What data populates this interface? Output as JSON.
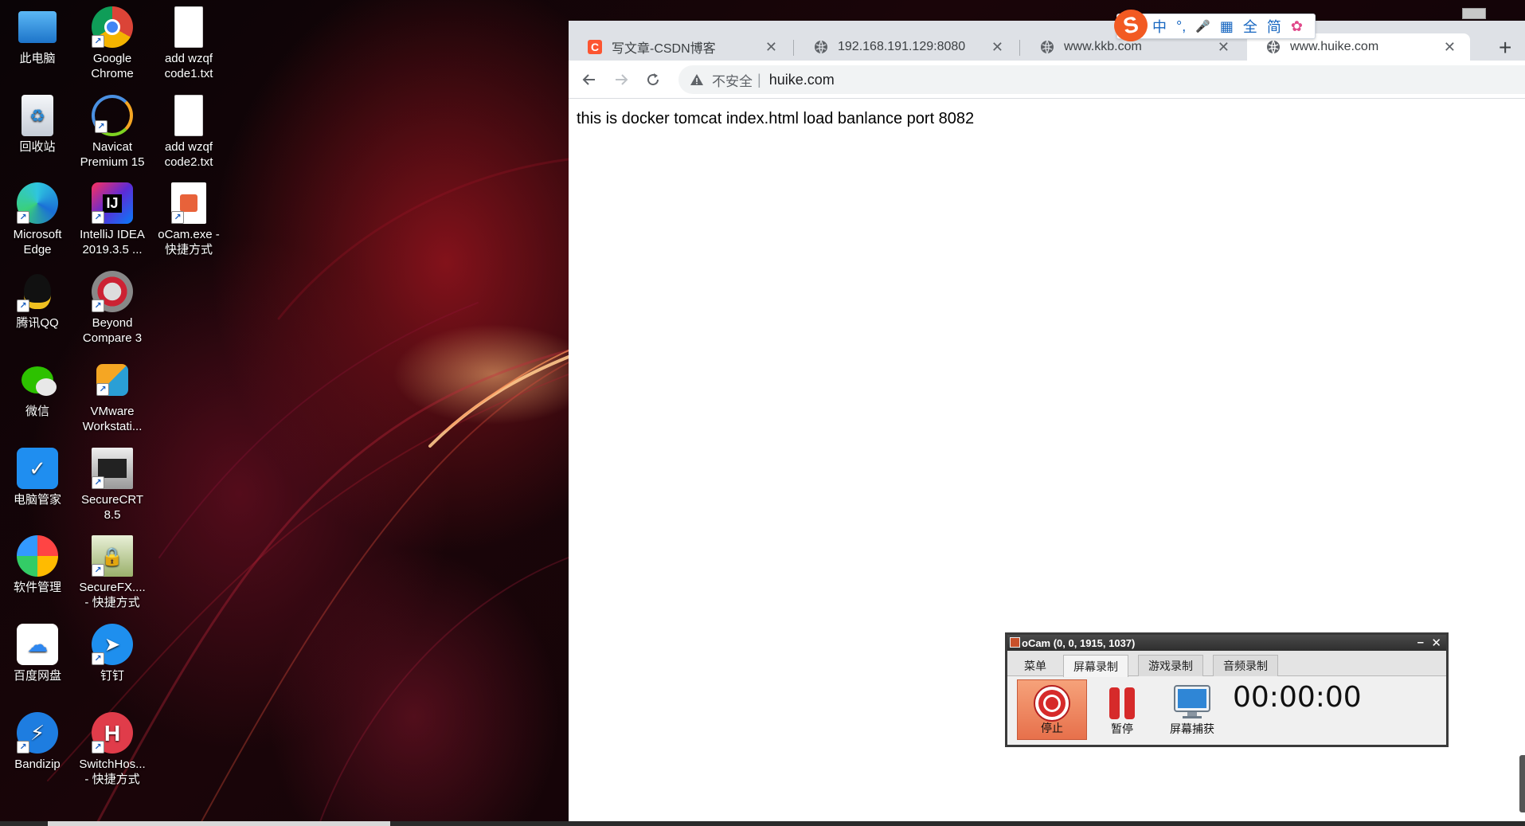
{
  "desktop": {
    "icons": [
      {
        "label": "此电脑",
        "icon": "computer-icon"
      },
      {
        "label": "Google Chrome",
        "icon": "chrome-icon"
      },
      {
        "label": "add wzqf code1.txt",
        "icon": "text-file-icon"
      },
      {
        "label": "回收站",
        "icon": "recycle-bin-icon"
      },
      {
        "label": "Navicat Premium 15",
        "icon": "navicat-icon"
      },
      {
        "label": "add wzqf code2.txt",
        "icon": "text-file-icon"
      },
      {
        "label": "Microsoft Edge",
        "icon": "edge-icon"
      },
      {
        "label": "IntelliJ IDEA 2019.3.5 ...",
        "icon": "intellij-icon"
      },
      {
        "label": "oCam.exe - 快捷方式",
        "icon": "ocam-icon"
      },
      {
        "label": "腾讯QQ",
        "icon": "qq-icon"
      },
      {
        "label": "Beyond Compare 3",
        "icon": "beyond-compare-icon"
      },
      {
        "label": "微信",
        "icon": "wechat-icon"
      },
      {
        "label": "VMware Workstati...",
        "icon": "vmware-icon"
      },
      {
        "label": "电脑管家",
        "icon": "pc-manager-icon"
      },
      {
        "label": "SecureCRT 8.5",
        "icon": "securecrt-icon"
      },
      {
        "label": "软件管理",
        "icon": "software-manager-icon"
      },
      {
        "label": "SecureFX.... - 快捷方式",
        "icon": "securefx-icon"
      },
      {
        "label": "百度网盘",
        "icon": "baidu-netdisk-icon"
      },
      {
        "label": "钉钉",
        "icon": "dingtalk-icon"
      },
      {
        "label": "Bandizip",
        "icon": "bandizip-icon"
      },
      {
        "label": "SwitchHos... - 快捷方式",
        "icon": "switchhosts-icon"
      }
    ]
  },
  "browser": {
    "tabs": [
      {
        "title": "写文章-CSDN博客",
        "icon": "csdn-icon",
        "active": false
      },
      {
        "title": "192.168.191.129:8080",
        "icon": "globe-icon",
        "active": false
      },
      {
        "title": "www.kkb.com",
        "icon": "globe-icon",
        "active": false
      },
      {
        "title": "www.huike.com",
        "icon": "globe-icon",
        "active": true
      }
    ],
    "close_glyph": "✕",
    "new_tab_glyph": "+",
    "address": {
      "security_label": "不安全",
      "url": "huike.com"
    },
    "page_text": "this is docker tomcat index.html load banlance port 8082"
  },
  "ime": {
    "logo": "S",
    "items": [
      "中",
      "°,",
      "🎤",
      "▦",
      "全",
      "简",
      "✿"
    ]
  },
  "ocam": {
    "title": "oCam (0, 0, 1915, 1037)",
    "tabs": [
      "菜单",
      "屏幕录制",
      "游戏录制",
      "音频录制"
    ],
    "active_tab": "屏幕录制",
    "buttons": {
      "stop": "停止",
      "pause": "暂停",
      "capture": "屏幕捕获"
    },
    "timer": "00:00:00",
    "minimize_glyph": "–",
    "close_glyph": "✕"
  },
  "colors": {
    "tab_strip": "#dee1e6",
    "ime_accent": "#f25a22",
    "ocam_stop": "#e7704b"
  }
}
